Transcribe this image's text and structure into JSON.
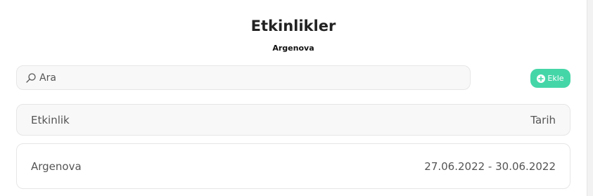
{
  "page": {
    "title": "Etkinlikler",
    "subtitle": "Argenova"
  },
  "search": {
    "placeholder": "Ara",
    "value": "",
    "icon": "search-icon"
  },
  "toolbar": {
    "add_label": "Ekle",
    "add_icon": "plus-circle-icon",
    "accent_color": "#45d6a8"
  },
  "table": {
    "columns": [
      "Etkinlik",
      "Tarih"
    ],
    "rows": [
      {
        "event": "Argenova",
        "date": "27.06.2022 - 30.06.2022"
      }
    ]
  }
}
